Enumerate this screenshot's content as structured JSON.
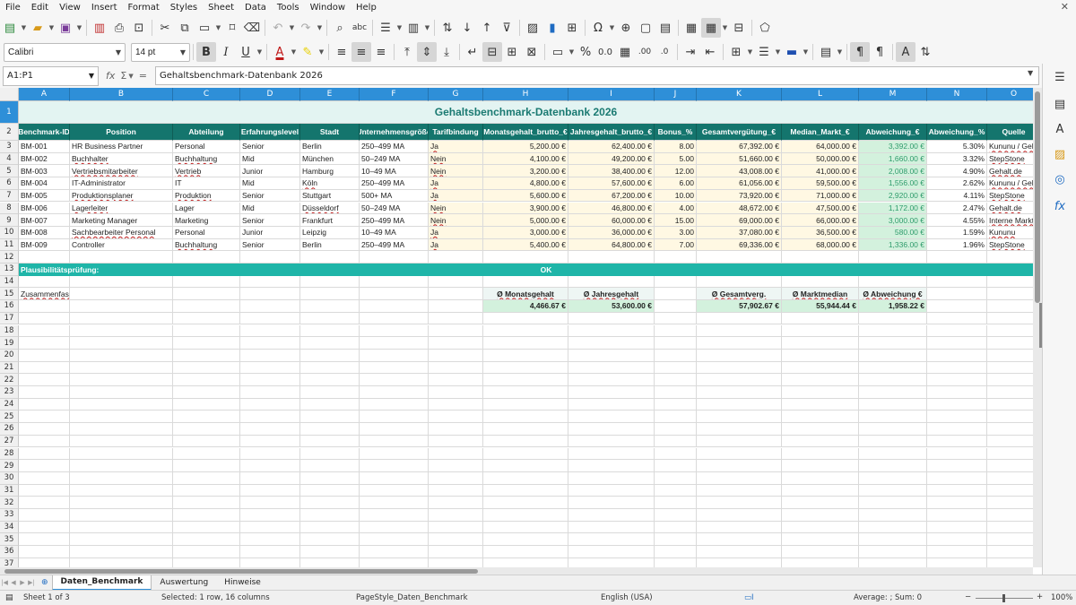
{
  "menu": [
    "File",
    "Edit",
    "View",
    "Insert",
    "Format",
    "Styles",
    "Sheet",
    "Data",
    "Tools",
    "Window",
    "Help"
  ],
  "font": {
    "name": "Calibri",
    "size": "14 pt"
  },
  "namebox": "A1:P1",
  "formula": "Gehaltsbenchmark-Datenbank 2026",
  "columns": [
    "A",
    "B",
    "C",
    "D",
    "E",
    "F",
    "G",
    "H",
    "I",
    "J",
    "K",
    "L",
    "M",
    "N",
    "O"
  ],
  "title": "Gehaltsbenchmark-Datenbank 2026",
  "headers": [
    "Benchmark-ID",
    "Position",
    "Abteilung",
    "Erfahrungslevel",
    "Stadt",
    "Unternehmensgröße",
    "Tarifbindung",
    "Monatsgehalt_brutto_€",
    "Jahresgehalt_brutto_€",
    "Bonus_%",
    "Gesamtvergütung_€",
    "Median_Markt_€",
    "Abweichung_€",
    "Abweichung_%",
    "Quelle"
  ],
  "data_rows": [
    [
      "BM-001",
      "HR Business Partner",
      "Personal",
      "Senior",
      "Berlin",
      "250–499 MA",
      "Ja",
      "5,200.00 €",
      "62,400.00 €",
      "8.00",
      "67,392.00 €",
      "64,000.00 €",
      "3,392.00 €",
      "5.30%",
      "Kununu / Gehalt.de"
    ],
    [
      "BM-002",
      "Buchhalter",
      "Buchhaltung",
      "Mid",
      "München",
      "50–249 MA",
      "Nein",
      "4,100.00 €",
      "49,200.00 €",
      "5.00",
      "51,660.00 €",
      "50,000.00 €",
      "1,660.00 €",
      "3.32%",
      "StepStone"
    ],
    [
      "BM-003",
      "Vertriebsmitarbeiter",
      "Vertrieb",
      "Junior",
      "Hamburg",
      "10–49 MA",
      "Nein",
      "3,200.00 €",
      "38,400.00 €",
      "12.00",
      "43,008.00 €",
      "41,000.00 €",
      "2,008.00 €",
      "4.90%",
      "Gehalt.de"
    ],
    [
      "BM-004",
      "IT-Administrator",
      "IT",
      "Mid",
      "Köln",
      "250–499 MA",
      "Ja",
      "4,800.00 €",
      "57,600.00 €",
      "6.00",
      "61,056.00 €",
      "59,500.00 €",
      "1,556.00 €",
      "2.62%",
      "Kununu / Gehalt.de"
    ],
    [
      "BM-005",
      "Produktionsplaner",
      "Produktion",
      "Senior",
      "Stuttgart",
      "500+ MA",
      "Ja",
      "5,600.00 €",
      "67,200.00 €",
      "10.00",
      "73,920.00 €",
      "71,000.00 €",
      "2,920.00 €",
      "4.11%",
      "StepStone"
    ],
    [
      "BM-006",
      "Lagerleiter",
      "Lager",
      "Mid",
      "Düsseldorf",
      "50–249 MA",
      "Nein",
      "3,900.00 €",
      "46,800.00 €",
      "4.00",
      "48,672.00 €",
      "47,500.00 €",
      "1,172.00 €",
      "2.47%",
      "Gehalt.de"
    ],
    [
      "BM-007",
      "Marketing Manager",
      "Marketing",
      "Senior",
      "Frankfurt",
      "250–499 MA",
      "Nein",
      "5,000.00 €",
      "60,000.00 €",
      "15.00",
      "69,000.00 €",
      "66,000.00 €",
      "3,000.00 €",
      "4.55%",
      "Interne Marktdaten"
    ],
    [
      "BM-008",
      "Sachbearbeiter Personal",
      "Personal",
      "Junior",
      "Leipzig",
      "10–49 MA",
      "Ja",
      "3,000.00 €",
      "36,000.00 €",
      "3.00",
      "37,080.00 €",
      "36,500.00 €",
      "580.00 €",
      "1.59%",
      "Kununu"
    ],
    [
      "BM-009",
      "Controller",
      "Buchhaltung",
      "Senior",
      "Berlin",
      "250–499 MA",
      "Ja",
      "5,400.00 €",
      "64,800.00 €",
      "7.00",
      "69,336.00 €",
      "68,000.00 €",
      "1,336.00 €",
      "1.96%",
      "StepStone"
    ]
  ],
  "check": {
    "label": "Plausibilitätsprüfung:",
    "value": "OK"
  },
  "summary": {
    "label": "Zusammenfassung",
    "monat_h": "Ø Monatsgehalt",
    "monat_v": "4,466.67 €",
    "jahr_h": "Ø Jahresgehalt",
    "jahr_v": "53,600.00 €",
    "gesamt_h": "Ø Gesamtverg.",
    "gesamt_v": "57,902.67 €",
    "markt_h": "Ø Marktmedian",
    "markt_v": "55,944.44 €",
    "abw_h": "Ø Abweichung €",
    "abw_v": "1,958.22 €"
  },
  "tabs": [
    "Daten_Benchmark",
    "Auswertung",
    "Hinweise"
  ],
  "active_tab": "Daten_Benchmark",
  "status": {
    "sheet": "Sheet 1 of 3",
    "selection": "Selected: 1 row, 16 columns",
    "pagestyle": "PageStyle_Daten_Benchmark",
    "language": "English (USA)",
    "sum": "Average: ; Sum: 0",
    "zoom": "100%"
  },
  "colors": {
    "header": "#14756d",
    "title_bg": "#e3f4f2",
    "band": "#1fb5a8",
    "yellow": "#fff8e3",
    "green": "#d3f1dd",
    "selection": "#2e8fd8"
  }
}
